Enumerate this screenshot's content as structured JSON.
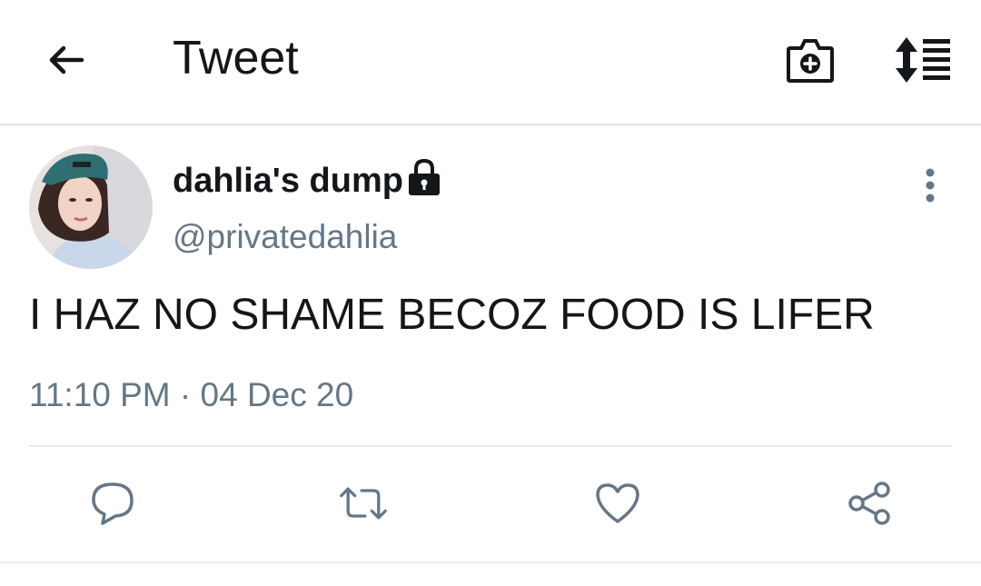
{
  "header": {
    "back_icon": "arrow-left-icon",
    "title": "Tweet",
    "camera_icon": "camera-plus-icon",
    "sort_icon": "sort-list-icon"
  },
  "tweet": {
    "display_name": "dahlia's dump",
    "protected_icon": "lock-icon",
    "handle": "@privatedahlia",
    "text": "I HAZ NO SHAME BECOZ FOOD IS LIFER",
    "timestamp": "11:10 PM · 04 Dec 20",
    "more_icon": "more-vertical-icon"
  },
  "actions": {
    "reply_icon": "reply-icon",
    "retweet_icon": "retweet-icon",
    "like_icon": "heart-icon",
    "share_icon": "share-icon"
  },
  "colors": {
    "primary_text": "#14171a",
    "secondary_text": "#657786",
    "divider": "#e6ecf0"
  }
}
